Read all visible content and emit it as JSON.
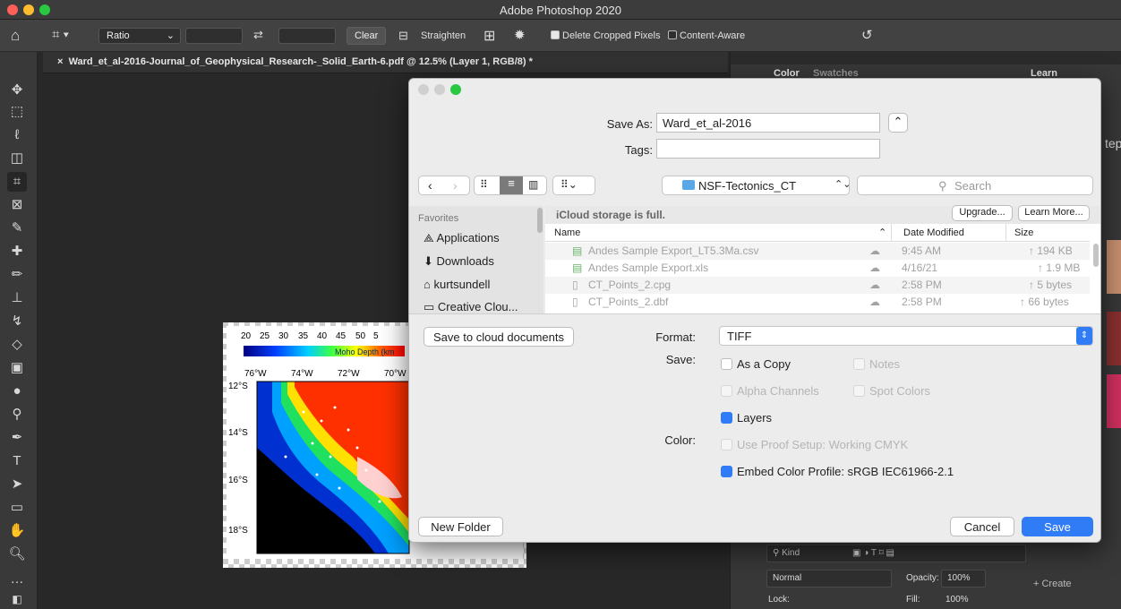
{
  "window": {
    "title": "Adobe Photoshop 2020"
  },
  "options_bar": {
    "ratio_label": "Ratio",
    "clear_label": "Clear",
    "straighten_label": "Straighten",
    "delete_cropped_label": "Delete Cropped Pixels",
    "content_aware_label": "Content-Aware"
  },
  "document": {
    "tab_title": "Ward_et_al-2016-Journal_of_Geophysical_Research-_Solid_Earth-6.pdf @ 12.5% (Layer 1, RGB/8) *"
  },
  "map_image": {
    "scale_ticks": [
      "20",
      "25",
      "30",
      "35",
      "40",
      "45",
      "50",
      "5"
    ],
    "scale_label": "Moho Depth (km",
    "lon_ticks": [
      "76°W",
      "74°W",
      "72°W",
      "70°W"
    ],
    "lat_ticks": [
      "12°S",
      "14°S",
      "16°S",
      "18°S"
    ]
  },
  "right_panel": {
    "color_tab": "Color",
    "swatches_tab": "Swatches",
    "learn_tab": "Learn",
    "side_text": "tep",
    "kind_label": "Kind",
    "blend_mode": "Normal",
    "opacity_label": "Opacity:",
    "opacity_value": "100%",
    "lock_label": "Lock:",
    "fill_label": "Fill:",
    "fill_value": "100%",
    "create_label": "+ Create"
  },
  "save_dialog": {
    "save_as_label": "Save As:",
    "save_as_value": "Ward_et_al-2016",
    "tags_label": "Tags:",
    "tags_value": "",
    "location": "NSF-Tectonics_CT",
    "search_placeholder": "Search",
    "favorites_header": "Favorites",
    "favorites": [
      "Applications",
      "Downloads",
      "kurtsundell",
      "Creative Clou..."
    ],
    "icloud_notice": "iCloud storage is full.",
    "upgrade_button": "Upgrade...",
    "learn_more_button": "Learn More...",
    "columns": {
      "name": "Name",
      "date": "Date Modified",
      "size": "Size"
    },
    "files": [
      {
        "name": "Andes Sample Export_LT5.3Ma.csv",
        "date": "9:45 AM",
        "size": "↑ 194 KB"
      },
      {
        "name": "Andes Sample Export.xls",
        "date": "4/16/21",
        "size": "↑ 1.9 MB"
      },
      {
        "name": "CT_Points_2.cpg",
        "date": "2:58 PM",
        "size": "↑ 5 bytes"
      },
      {
        "name": "CT_Points_2.dbf",
        "date": "2:58 PM",
        "size": "↑ 66 bytes"
      }
    ],
    "save_to_cloud_button": "Save to cloud documents",
    "format_label": "Format:",
    "format_value": "TIFF",
    "save_label": "Save:",
    "color_label": "Color:",
    "options": {
      "as_a_copy": {
        "label": "As a Copy",
        "checked": false,
        "enabled": true
      },
      "notes": {
        "label": "Notes",
        "checked": false,
        "enabled": false
      },
      "alpha_channels": {
        "label": "Alpha Channels",
        "checked": false,
        "enabled": false
      },
      "spot_colors": {
        "label": "Spot Colors",
        "checked": false,
        "enabled": false
      },
      "layers": {
        "label": "Layers",
        "checked": true,
        "enabled": true
      },
      "use_proof_setup": {
        "label": "Use Proof Setup:  Working CMYK",
        "checked": false,
        "enabled": false
      },
      "embed_color_profile": {
        "label": "Embed Color Profile:  sRGB IEC61966-2.1",
        "checked": true,
        "enabled": true
      }
    },
    "new_folder_button": "New Folder",
    "cancel_button": "Cancel",
    "save_button": "Save"
  },
  "colors": {
    "accent": "#2f7cf6",
    "close": "#fe5f57",
    "minimize": "#febc2e",
    "zoom": "#28c840"
  }
}
